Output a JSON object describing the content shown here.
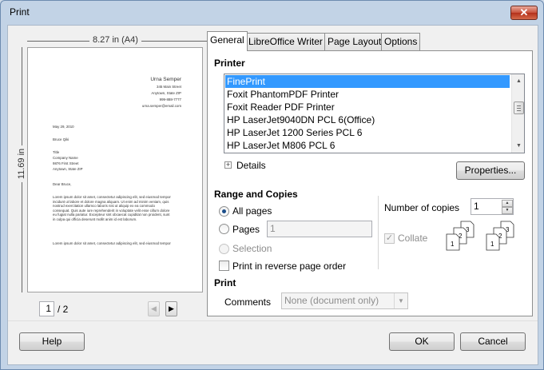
{
  "window": {
    "title": "Print",
    "close_label": "✕"
  },
  "preview": {
    "width_label": "8.27 in (A4)",
    "height_label": "11.69 in",
    "sender_name": "Urna Semper",
    "sender_address": [
      "345 Main Street",
      "Anytown, State ZIP",
      "999-888-7777",
      "urna.semper@email.com"
    ],
    "date": "May 29, 2010",
    "recipient": [
      "Bruce Qiki",
      "",
      "Title",
      "Company Name",
      "9876 First Street",
      "Anytown, State ZIP"
    ],
    "salutation": "Dear Bruce,",
    "para1": "Lorem ipsum dolor sit amet, consectetur adipiscing elit, sed eiusmod tempor incidunt ut labore et dolore magna aliquam. Ut enim ad minim veniam, quis nostrud exercitation ullamco laboris nisi ut aliquip ex ea commodo consequat. Quis aute iure reprehenderit in voluptate velit esse cillum dolore eu fugiat nulla pariatur. Excepteur sint obcaecat cupiditat non proident, sunt in culpa qui officia deserunt mollit anim id est laborum.",
    "para2": "Lorem ipsum dolor sit amet, consectetur adipiscing elit, sed eiusmod tempor",
    "page_current": "1",
    "page_total": "/ 2",
    "prev_glyph": "◀",
    "next_glyph": "▶"
  },
  "tabs": [
    {
      "label": "General",
      "active": true
    },
    {
      "label": "LibreOffice Writer",
      "active": false
    },
    {
      "label": "Page Layout",
      "active": false
    },
    {
      "label": "Options",
      "active": false
    }
  ],
  "general": {
    "printer_heading": "Printer",
    "printers": [
      {
        "name": "FinePrint",
        "selected": true
      },
      {
        "name": "Foxit PhantomPDF Printer",
        "selected": false
      },
      {
        "name": "Foxit Reader PDF Printer",
        "selected": false
      },
      {
        "name": "HP LaserJet9040DN PCL 6(Office)",
        "selected": false
      },
      {
        "name": "HP LaserJet 1200 Series PCL 6",
        "selected": false
      },
      {
        "name": "HP LaserJet M806 PCL 6",
        "selected": false
      }
    ],
    "details_label": "Details",
    "properties_label": "Properties...",
    "range_heading": "Range and Copies",
    "all_pages_label": "All pages",
    "pages_label": "Pages",
    "pages_value": "1",
    "selection_label": "Selection",
    "reverse_label": "Print in reverse page order",
    "copies_label": "Number of copies",
    "copies_value": "1",
    "collate_label": "Collate",
    "print_heading": "Print",
    "comments_label": "Comments",
    "comments_value": "None (document only)",
    "range_selected": "all_pages"
  },
  "footer": {
    "help_label": "Help",
    "ok_label": "OK",
    "cancel_label": "Cancel"
  }
}
